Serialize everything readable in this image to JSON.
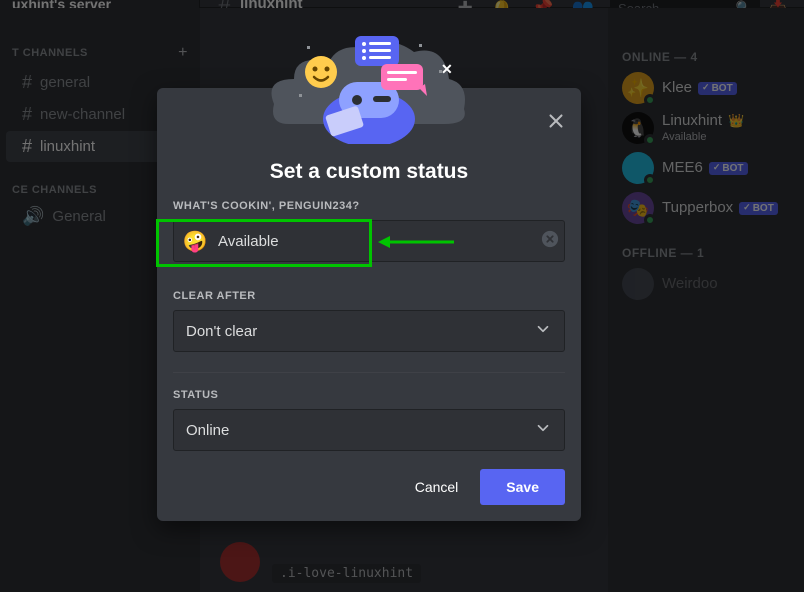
{
  "server_name": "uxhint's server",
  "channel_title": "linuxhint",
  "search_placeholder": "Search",
  "sidebar": {
    "text_header": "T CHANNELS",
    "voice_header": "CE CHANNELS",
    "text_channels": [
      {
        "name": "general"
      },
      {
        "name": "new-channel"
      },
      {
        "name": "linuxhint",
        "active": true
      }
    ],
    "voice_channels": [
      {
        "name": "General"
      }
    ]
  },
  "members": {
    "online_header": "ONLINE — 4",
    "offline_header": "OFFLINE — 1",
    "online": [
      {
        "name": "Klee",
        "bot": true,
        "avatar_bg": "av-klee",
        "glyph": "✨"
      },
      {
        "name": "Linuxhint",
        "owner": true,
        "substatus": "Available",
        "avatar_bg": "av-lh",
        "glyph": "🐧"
      },
      {
        "name": "MEE6",
        "bot": true,
        "avatar_bg": "av-mee6",
        "glyph": ""
      },
      {
        "name": "Tupperbox",
        "bot": true,
        "avatar_bg": "av-tupper",
        "glyph": "🎭"
      }
    ],
    "offline": [
      {
        "name": "Weirdoo",
        "avatar_bg": "av-off",
        "glyph": ""
      }
    ]
  },
  "modal": {
    "title": "Set a custom status",
    "prompt": "WHAT'S COOKIN', PENGUIN234?",
    "status_emoji": "🤪",
    "status_text": "Available",
    "clear_label": "CLEAR AFTER",
    "clear_value": "Don't clear",
    "status_label": "STATUS",
    "status_value": "Online",
    "cancel": "Cancel",
    "save": "Save"
  },
  "chat": {
    "code_line": ".i-love-linuxhint"
  },
  "bot_tag_text": "BOT"
}
